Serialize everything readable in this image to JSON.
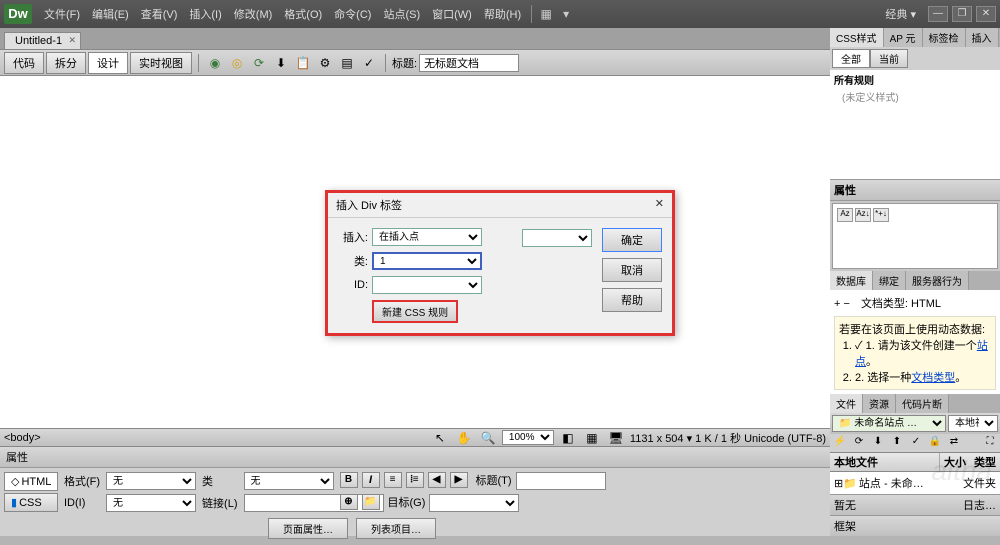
{
  "app": {
    "logo": "Dw",
    "workspace": "经典"
  },
  "menus": [
    "文件(F)",
    "编辑(E)",
    "查看(V)",
    "插入(I)",
    "修改(M)",
    "格式(O)",
    "命令(C)",
    "站点(S)",
    "窗口(W)",
    "帮助(H)"
  ],
  "file_tab": "Untitled-1",
  "views": {
    "code": "代码",
    "split": "拆分",
    "design": "设计",
    "live": "实时视图"
  },
  "toolbar": {
    "title_label": "标题:",
    "title_value": "无标题文档"
  },
  "status": {
    "tag": "<body>",
    "zoom": "100%",
    "dims": "1131 x 504 ▾ 1 K / 1 秒 Unicode (UTF-8)"
  },
  "dialog": {
    "title": "插入 Div 标签",
    "insert_label": "插入:",
    "insert_value": "在插入点",
    "class_label": "类:",
    "class_value": "1",
    "id_label": "ID:",
    "id_value": "",
    "new_css": "新建 CSS 规则",
    "ok": "确定",
    "cancel": "取消",
    "help": "帮助"
  },
  "panels": {
    "css": {
      "tabs": [
        "CSS样式",
        "AP 元",
        "标签检",
        "插入"
      ],
      "subtabs": [
        "全部",
        "当前"
      ],
      "all_rules": "所有规则",
      "no_styles": "(未定义样式)"
    },
    "properties": {
      "header": "属性"
    },
    "database": {
      "tabs": [
        "数据库",
        "绑定",
        "服务器行为"
      ],
      "doc_type": "文档类型: HTML",
      "note_intro": "若要在该页面上使用动态数据:",
      "note_1_pre": "1. 请为该文件创建一个",
      "note_1_link": "站点",
      "note_1_post": "。",
      "note_2_pre": "2. 选择一种",
      "note_2_link": "文档类型",
      "note_2_post": "。"
    },
    "files": {
      "tabs": [
        "文件",
        "资源",
        "代码片断"
      ],
      "site_select": "未命名站点 …",
      "view_select": "本地视图",
      "cols": [
        "本地文件",
        "大小",
        "类型"
      ],
      "row1": "站点 - 未命…",
      "row1_type": "文件夹"
    },
    "bottom_tabs": [
      "框架",
      "日志…"
    ],
    "bottom_end": "暂无"
  },
  "propbar": {
    "header": "属性",
    "html_tab": "HTML",
    "css_tab": "CSS",
    "format_label": "格式(F)",
    "format_value": "无",
    "id_label": "ID(I)",
    "id_value": "无",
    "class_label": "类",
    "class_value": "无",
    "link_label": "链接(L)",
    "link_value": "",
    "title_label": "标题(T)",
    "target_label": "目标(G)",
    "page_props": "页面属性…",
    "list_props": "列表项目…"
  }
}
